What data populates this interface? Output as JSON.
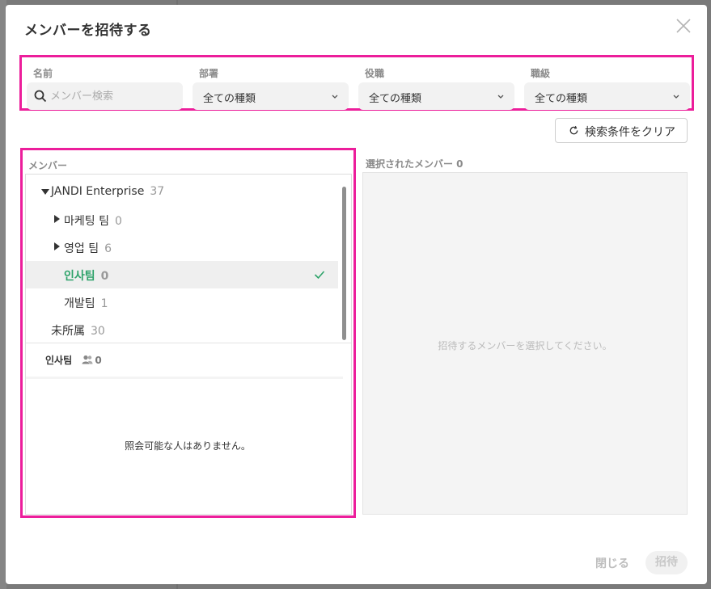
{
  "dialog": {
    "title": "メンバーを招待する",
    "close_icon": "close-icon"
  },
  "filters": {
    "name": {
      "label": "名前",
      "placeholder": "メンバー検索",
      "value": ""
    },
    "department": {
      "label": "部署",
      "value": "全ての種類"
    },
    "role": {
      "label": "役職",
      "value": "全ての種類"
    },
    "rank": {
      "label": "職級",
      "value": "全ての種類"
    },
    "clear_label": "検索条件をクリア"
  },
  "members": {
    "label": "メンバー",
    "tree": [
      {
        "name": "JANDI Enterprise",
        "count": "37",
        "expanded": true
      },
      {
        "name": "마케팅 팀",
        "count": "0",
        "expanded": false
      },
      {
        "name": "영업 팀",
        "count": "6",
        "expanded": false
      },
      {
        "name": "인사팀",
        "count": "0",
        "selected": true
      },
      {
        "name": "개발팀",
        "count": "1"
      },
      {
        "name": "未所属",
        "count": "30"
      }
    ],
    "current_team": {
      "name": "인사팀",
      "count": "0"
    },
    "empty_message": "照会可能な人はありません。"
  },
  "selected": {
    "label": "選択されたメンバー 0",
    "empty_message": "招待するメンバーを選択してください。"
  },
  "footer": {
    "close_label": "閉じる",
    "invite_label": "招待"
  },
  "colors": {
    "highlight_border": "#ec1e9b",
    "selected_green": "#2ea36a"
  }
}
